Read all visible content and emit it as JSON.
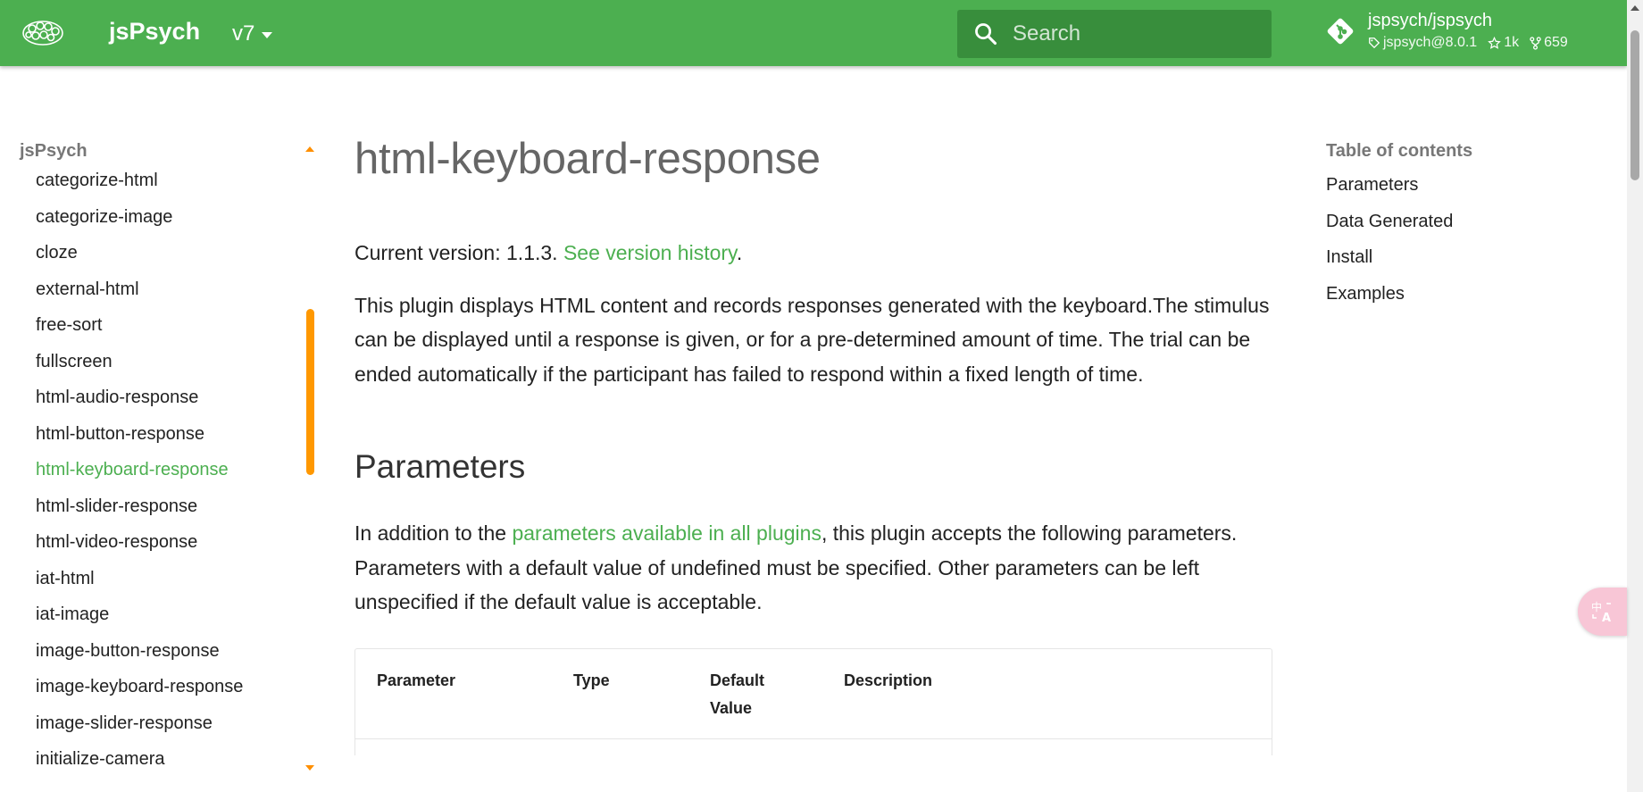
{
  "header": {
    "site_title": "jsPsych",
    "version": "v7",
    "search_placeholder": "Search",
    "repo": {
      "name": "jspsych/jspsych",
      "tag": "jspsych@8.0.1",
      "stars": "1k",
      "forks": "659"
    },
    "colors": {
      "primary": "#4caf50",
      "search_bg": "#388e3c"
    }
  },
  "sidebar": {
    "section": "jsPsych",
    "items": [
      "categorize-html",
      "categorize-image",
      "cloze",
      "external-html",
      "free-sort",
      "fullscreen",
      "html-audio-response",
      "html-button-response",
      "html-keyboard-response",
      "html-slider-response",
      "html-video-response",
      "iat-html",
      "iat-image",
      "image-button-response",
      "image-keyboard-response",
      "image-slider-response",
      "initialize-camera"
    ],
    "active_item": "html-keyboard-response",
    "accent": "#ff9800"
  },
  "main": {
    "title": "html-keyboard-response",
    "version_prefix": "Current version: 1.1.3. ",
    "version_link": "See version history",
    "version_suffix": ".",
    "description": "This plugin displays HTML content and records responses generated with the keyboard.The stimulus can be displayed until a response is given, or for a pre-determined amount of time. The trial can be ended automatically if the participant has failed to respond within a fixed length of time.",
    "parameters_heading": "Parameters",
    "params_intro_prefix": "In addition to the ",
    "params_intro_link": "parameters available in all plugins",
    "params_intro_suffix": ", this plugin accepts the following parameters. Parameters with a default value of undefined must be specified. Other parameters can be left unspecified if the default value is acceptable.",
    "table_headers": {
      "parameter": "Parameter",
      "type": "Type",
      "default_value": "Default Value",
      "description": "Description"
    }
  },
  "toc": {
    "title": "Table of contents",
    "items": [
      "Parameters",
      "Data Generated",
      "Install",
      "Examples"
    ]
  },
  "floating": {
    "translate_icon": "translate-icon"
  }
}
